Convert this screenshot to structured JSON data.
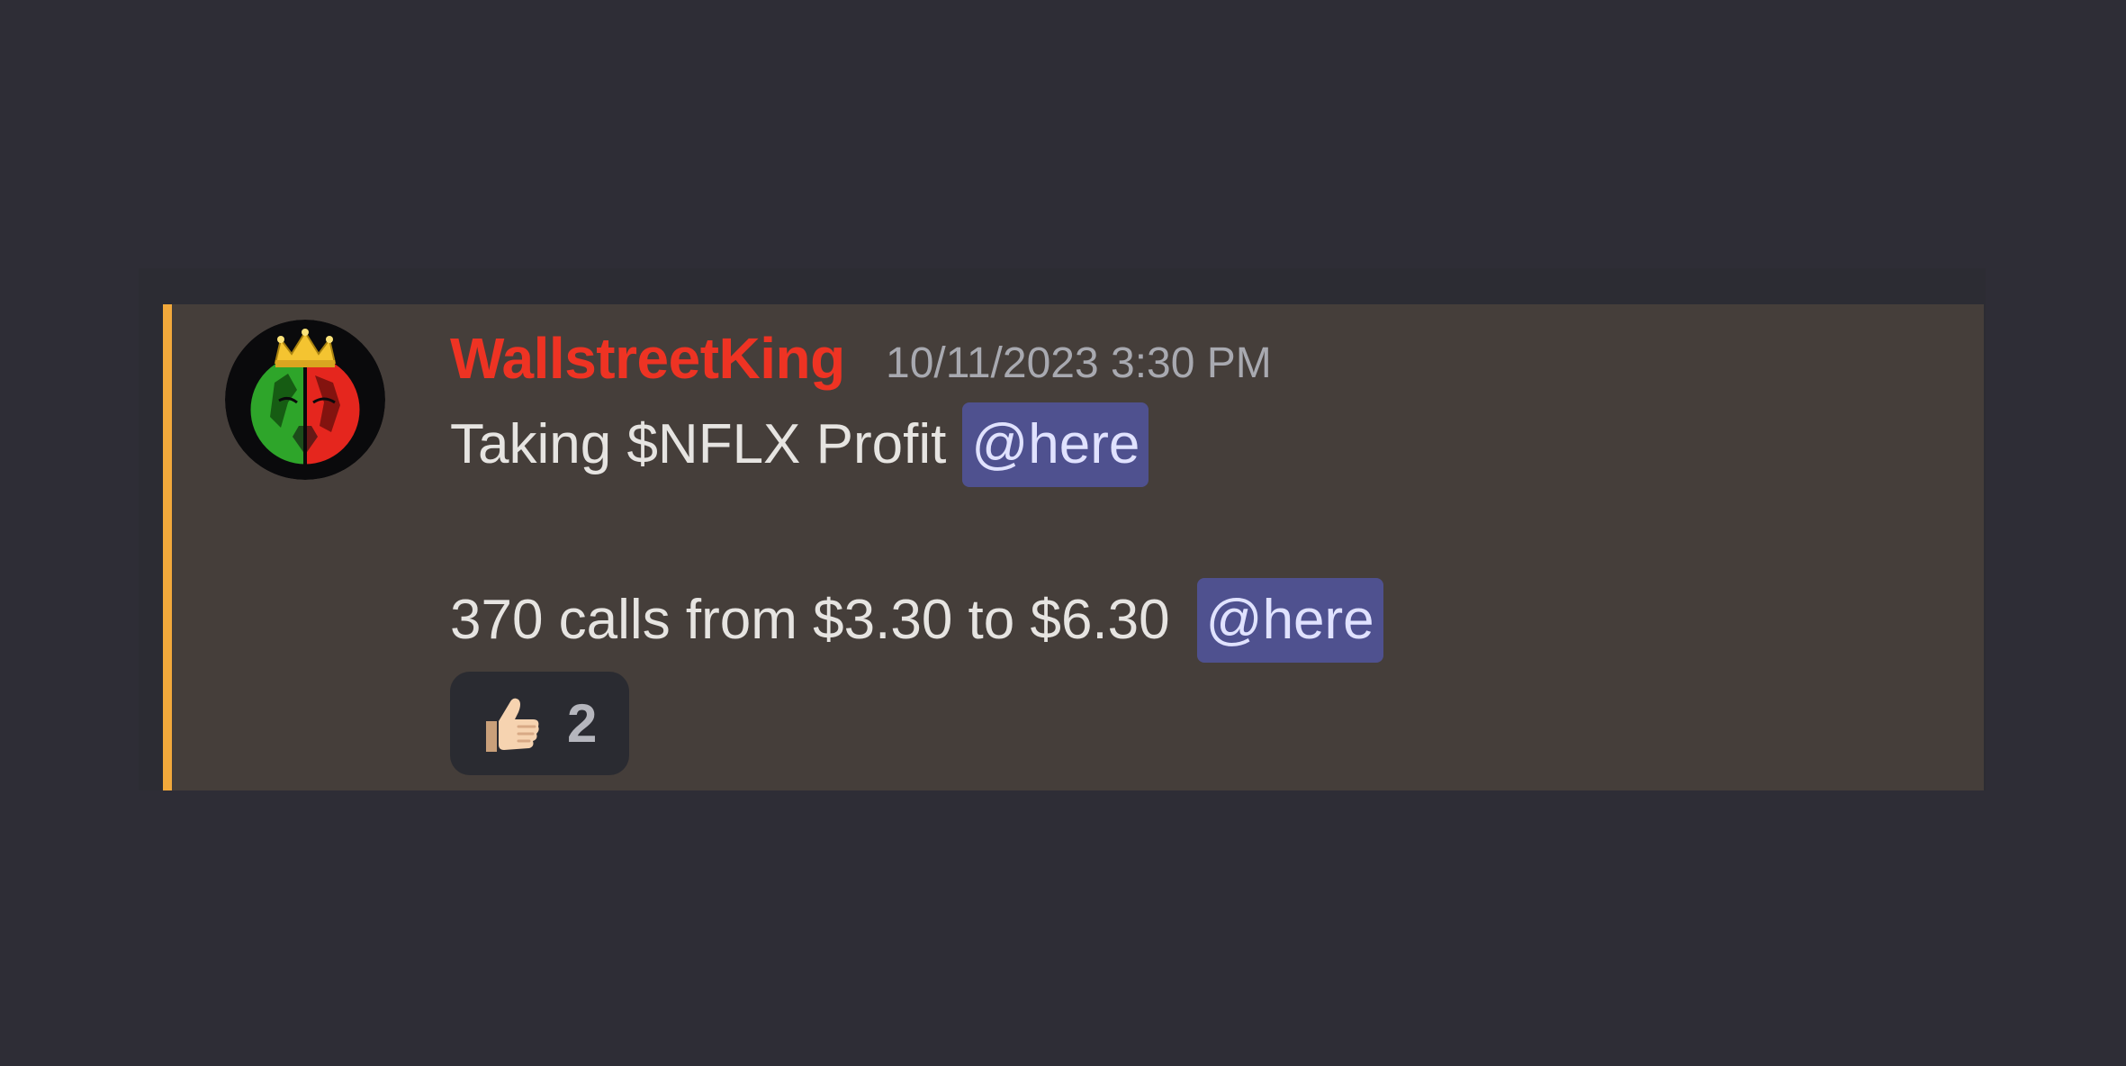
{
  "message": {
    "author": {
      "username": "WallstreetKing",
      "username_color": "#ee3323",
      "avatar_icon": "lion-crown-avatar-icon"
    },
    "timestamp": "10/11/2023 3:30 PM",
    "lines": [
      {
        "text": "Taking $NFLX Profit",
        "mention": "@here"
      },
      {
        "text": "370 calls from $3.30 to $6.30",
        "mention": "@here"
      }
    ],
    "reactions": [
      {
        "emoji_icon": "thumbs-up-icon",
        "count": "2"
      }
    ],
    "highlight_color": "#f2a93b",
    "mention_color": "#4f518f"
  }
}
